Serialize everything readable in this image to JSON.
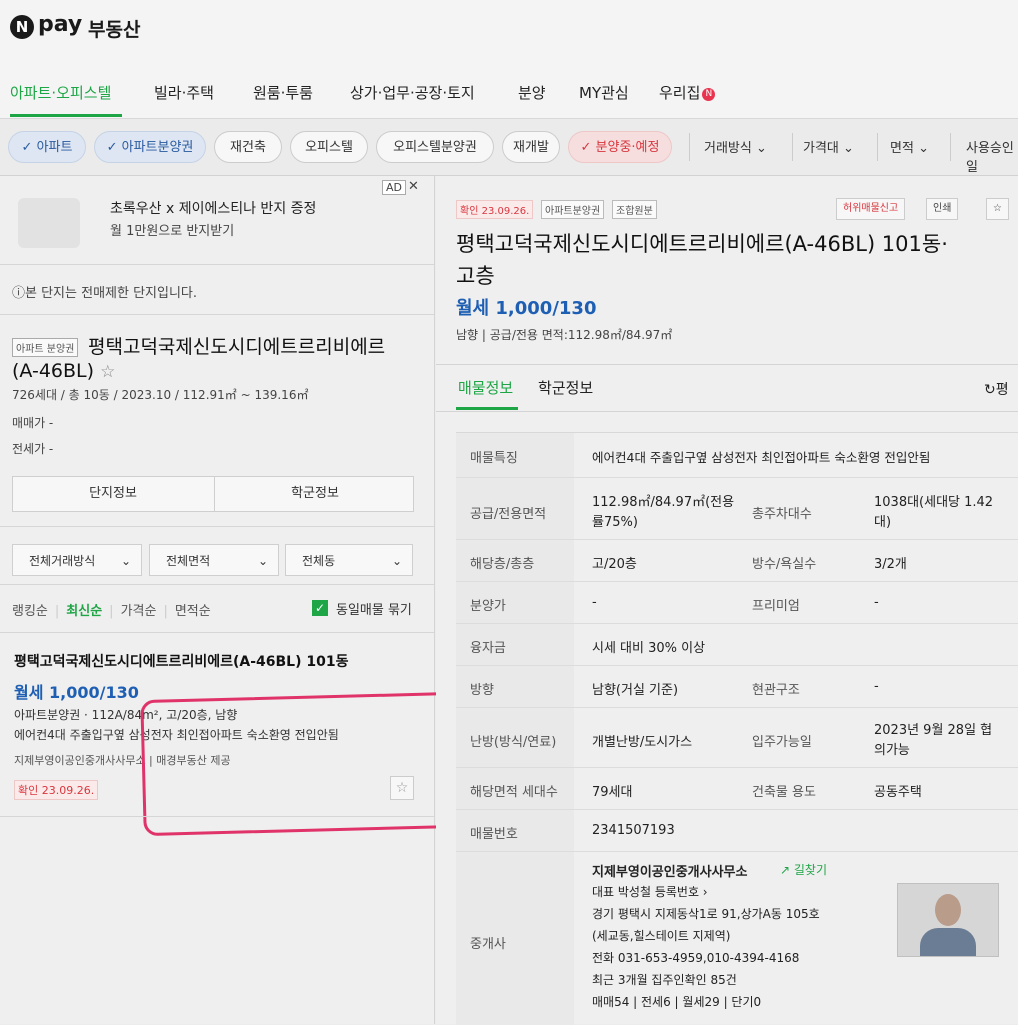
{
  "header": {
    "logo_n": "N",
    "logo_pay": "pay",
    "logo_realestate": "부동산"
  },
  "nav": {
    "items": [
      "아파트·오피스텔",
      "빌라·주택",
      "원룸·투룸",
      "상가·업무·공장·토지",
      "분양",
      "MY관심",
      "우리집"
    ],
    "badge": "N"
  },
  "filters": {
    "chips": [
      "✓ 아파트",
      "✓ 아파트분양권",
      "재건축",
      "오피스텔",
      "오피스텔분양권",
      "재개발",
      "✓ 분양중·예정"
    ],
    "dropdowns": [
      "거래방식",
      "가격대",
      "면적",
      "사용승인일"
    ]
  },
  "left": {
    "ad": {
      "title": "초록우산 x 제이에스티나 반지 증정",
      "subtitle": "월 1만원으로 반지받기",
      "label": "AD",
      "close": "✕"
    },
    "notice": "ⓘ본 단지는 전매제한 단지입니다.",
    "complex": {
      "tag": "아파트 분양권",
      "name_line1": "평택고덕국제신도시디에트르리비에르",
      "name_line2": "(A-46BL)",
      "star": "☆",
      "info": "726세대 / 총 10동 / 2023.10 / 112.91㎡ ~ 139.16㎡",
      "sale": "매매가 -",
      "jeonse": "전세가 -"
    },
    "tabs": [
      "단지정보",
      "학군정보"
    ],
    "selects": [
      "전체거래방식",
      "전체면적",
      "전체동"
    ],
    "sort": [
      "랭킹순",
      "최신순",
      "가격순",
      "면적순"
    ],
    "same_listing": "동일매물 묶기",
    "item": {
      "title": "평택고덕국제신도시디에트르리비에르(A-46BL) 101동",
      "price": "월세 1,000/130",
      "spec": "아파트분양권 · 112A/84m², 고/20층, 남향",
      "desc": "에어컨4대 주출입구옆 삼성전자 최인접아파트 숙소환영 전입안됨",
      "agent": "지제부영이공인중개사사무소 | 매경부동산 제공",
      "confirm": "확인 23.09.26.",
      "star": "☆"
    }
  },
  "right": {
    "tags": [
      "확인 23.09.26.",
      "아파트분양권",
      "조합원분"
    ],
    "buttons": [
      "허위매물신고",
      "인쇄",
      "☆"
    ],
    "title_line1": "평택고덕국제신도시디에트르리비에르(A-46BL) 101동·",
    "title_line2": "고층",
    "price": "월세 1,000/130",
    "sub": "남향 | 공급/전용 면적:112.98㎡/84.97㎡",
    "tabs": [
      "매물정보",
      "학군정보"
    ],
    "refresh": "↻평",
    "table": {
      "feature_label": "매물특징",
      "feature_value": "에어컨4대 주출입구옆 삼성전자 최인접아파트 숙소환영 전입안됨",
      "area_label": "공급/전용면적",
      "area_value1": "112.98㎡/84.97㎡(전용",
      "area_value2": "률75%)",
      "parking_label": "총주차대수",
      "parking_value1": "1038대(세대당 1.42",
      "parking_value2": "대)",
      "floor_label": "해당층/총층",
      "floor_value": "고/20층",
      "rooms_label": "방수/욕실수",
      "rooms_value": "3/2개",
      "presale_label": "분양가",
      "presale_value": "-",
      "premium_label": "프리미엄",
      "premium_value": "-",
      "loan_label": "융자금",
      "loan_value": "시세 대비 30% 이상",
      "direction_label": "방향",
      "direction_value": "남향(거실 기준)",
      "entrance_label": "현관구조",
      "entrance_value": "-",
      "heating_label": "난방(방식/연료)",
      "heating_value": "개별난방/도시가스",
      "movein_label": "입주가능일",
      "movein_value1": "2023년 9월 28일 협",
      "movein_value2": "의가능",
      "households_label": "해당면적 세대수",
      "households_value": "79세대",
      "usage_label": "건축물 용도",
      "usage_value": "공동주택",
      "number_label": "매물번호",
      "number_value": "2341507193",
      "agent_label": "중개사",
      "agent_name": "지제부영이공인중개사사무소",
      "directions": "↗ 길찾기",
      "rep": "대표 박성철 등록번호 ›",
      "addr1": "경기 평택시 지제동삭1로 91,상가A동 105호",
      "addr2": "(세교동,힐스테이트 지제역)",
      "phone": "전화 031-653-4959,010-4394-4168",
      "recent": "최근 3개월 집주인확인 85건",
      "counts": "매매54 | 전세6 | 월세29 | 단기0"
    }
  }
}
